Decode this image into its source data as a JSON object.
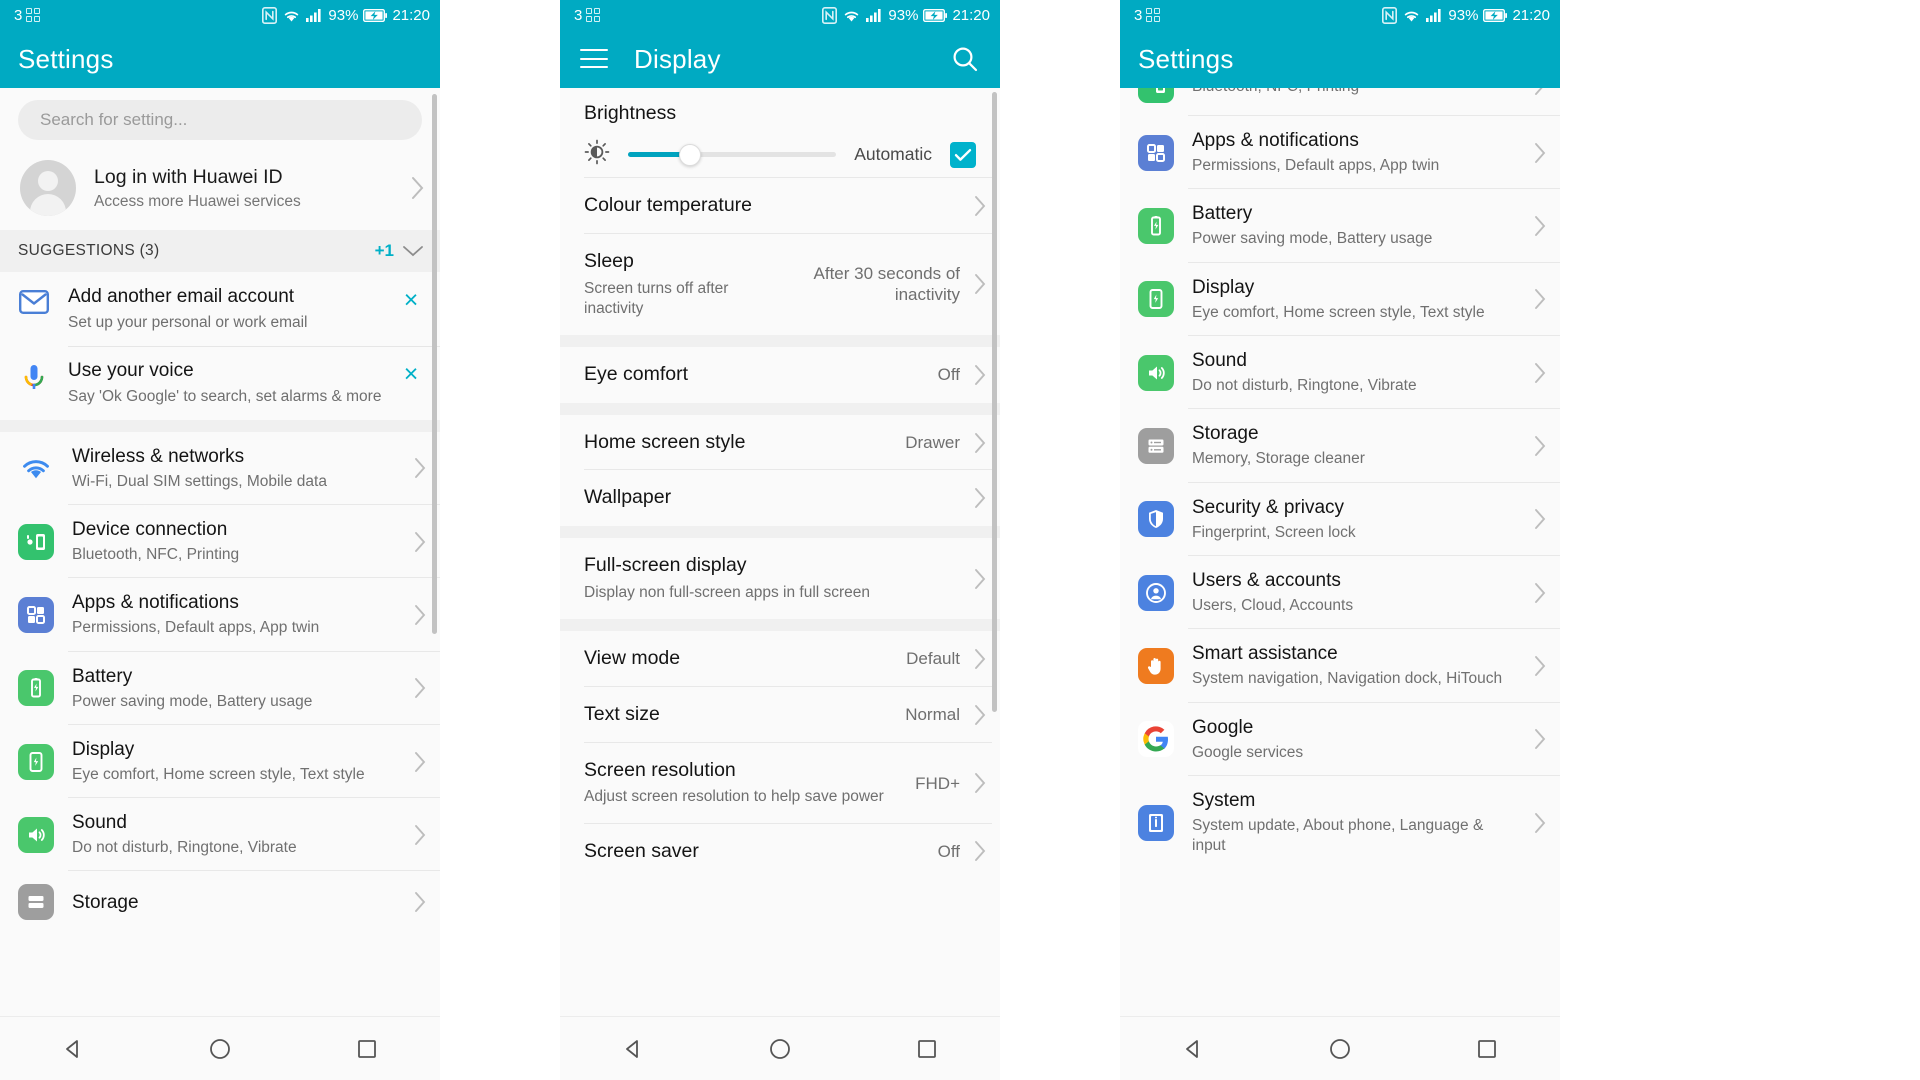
{
  "theme": {
    "accent": "#00aac2",
    "accent_light": "#00b2cc",
    "page_bg": "#fafafa",
    "divider": "#e8e8e8"
  },
  "status_bar": {
    "notification_count": "3",
    "notification_icon": "grid-icon",
    "nfc_icon": "nfc-icon",
    "wifi_icon": "wifi-icon",
    "signal_icon": "signal-bars-icon",
    "battery_percent": "93%",
    "battery_icon": "battery-charging-icon",
    "time": "21:20"
  },
  "panel1": {
    "appbar": {
      "title": "Settings"
    },
    "search": {
      "placeholder": "Search for setting...",
      "icon": "search-icon"
    },
    "account": {
      "avatar_icon": "user-avatar-icon",
      "title": "Log in with Huawei ID",
      "subtitle": "Access more Huawei services",
      "chevron": "chevron-right-icon"
    },
    "suggestions_header": {
      "label": "SUGGESTIONS (3)",
      "badge": "+1",
      "caret": "chevron-down-icon"
    },
    "suggestions": [
      {
        "icon": "email-icon",
        "icon_color": "#4a7fd6",
        "title": "Add another email account",
        "subtitle": "Set up your personal or work email",
        "dismiss": "×",
        "dismiss_icon": "close-icon"
      },
      {
        "icon": "microphone-icon",
        "icon_color": "#4285f4",
        "title": "Use your voice",
        "subtitle": "Say 'Ok Google' to search, set alarms & more",
        "dismiss": "×",
        "dismiss_icon": "close-icon"
      }
    ],
    "items": [
      {
        "icon": "wifi-network-icon",
        "icon_color": "#3d8bef",
        "title": "Wireless & networks",
        "subtitle": "Wi-Fi, Dual SIM settings, Mobile data"
      },
      {
        "icon": "device-connection-icon",
        "icon_color": "#33c26e",
        "title": "Device connection",
        "subtitle": "Bluetooth, NFC, Printing"
      },
      {
        "icon": "apps-grid-icon",
        "icon_color": "#5b7fd4",
        "title": "Apps & notifications",
        "subtitle": "Permissions, Default apps, App twin"
      },
      {
        "icon": "battery-icon",
        "icon_color": "#4ac76c",
        "title": "Battery",
        "subtitle": "Power saving mode, Battery usage"
      },
      {
        "icon": "display-icon",
        "icon_color": "#4ac76c",
        "title": "Display",
        "subtitle": "Eye comfort, Home screen style, Text style"
      },
      {
        "icon": "sound-icon",
        "icon_color": "#4ac76c",
        "title": "Sound",
        "subtitle": "Do not disturb, Ringtone, Vibrate"
      },
      {
        "icon": "storage-icon",
        "icon_color": "#9e9e9e",
        "title": "Storage",
        "subtitle": ""
      }
    ]
  },
  "panel2": {
    "appbar": {
      "title": "Display",
      "menu_icon": "hamburger-menu-icon",
      "search_icon": "search-icon"
    },
    "brightness": {
      "title": "Brightness",
      "icon": "brightness-sun-icon",
      "slider_percent": 30,
      "auto_label": "Automatic",
      "auto_checked": true,
      "check_icon": "checkmark-icon"
    },
    "items": [
      {
        "title": "Colour temperature",
        "subtitle": "",
        "value": ""
      },
      {
        "title": "Sleep",
        "subtitle": "Screen turns off after inactivity",
        "value": "After 30 seconds of inactivity"
      },
      {
        "title": "Eye comfort",
        "subtitle": "",
        "value": "Off"
      },
      {
        "title": "Home screen style",
        "subtitle": "",
        "value": "Drawer"
      },
      {
        "title": "Wallpaper",
        "subtitle": "",
        "value": ""
      },
      {
        "title": "Full-screen display",
        "subtitle": "Display non full-screen apps in full screen",
        "value": ""
      },
      {
        "title": "View mode",
        "subtitle": "",
        "value": "Default"
      },
      {
        "title": "Text size",
        "subtitle": "",
        "value": "Normal"
      },
      {
        "title": "Screen resolution",
        "subtitle": "Adjust screen resolution to help save power",
        "value": "FHD+"
      },
      {
        "title": "Screen saver",
        "subtitle": "",
        "value": "Off"
      }
    ]
  },
  "panel3": {
    "appbar": {
      "title": "Settings"
    },
    "items": [
      {
        "icon": "device-connection-icon",
        "icon_color": "#33c26e",
        "title": "",
        "subtitle": "Bluetooth, NFC, Printing"
      },
      {
        "icon": "apps-grid-icon",
        "icon_color": "#5b7fd4",
        "title": "Apps & notifications",
        "subtitle": "Permissions, Default apps, App twin"
      },
      {
        "icon": "battery-icon",
        "icon_color": "#4ac76c",
        "title": "Battery",
        "subtitle": "Power saving mode, Battery usage"
      },
      {
        "icon": "display-icon",
        "icon_color": "#4ac76c",
        "title": "Display",
        "subtitle": "Eye comfort, Home screen style, Text style"
      },
      {
        "icon": "sound-icon",
        "icon_color": "#4ac76c",
        "title": "Sound",
        "subtitle": "Do not disturb, Ringtone, Vibrate"
      },
      {
        "icon": "storage-icon",
        "icon_color": "#9e9e9e",
        "title": "Storage",
        "subtitle": "Memory, Storage cleaner"
      },
      {
        "icon": "shield-icon",
        "icon_color": "#4c82e0",
        "title": "Security & privacy",
        "subtitle": "Fingerprint, Screen lock"
      },
      {
        "icon": "users-accounts-icon",
        "icon_color": "#4c82e0",
        "title": "Users & accounts",
        "subtitle": "Users, Cloud, Accounts"
      },
      {
        "icon": "hand-icon",
        "icon_color": "#ef7b1f",
        "title": "Smart assistance",
        "subtitle": "System navigation, Navigation dock, HiTouch"
      },
      {
        "icon": "google-icon",
        "icon_color": "#ffffff",
        "title": "Google",
        "subtitle": "Google services"
      },
      {
        "icon": "system-info-icon",
        "icon_color": "#4c82e0",
        "title": "System",
        "subtitle": "System update, About phone, Language & input"
      }
    ]
  },
  "navbar": {
    "back": "back-triangle-icon",
    "home": "home-circle-icon",
    "recents": "recents-square-icon"
  }
}
